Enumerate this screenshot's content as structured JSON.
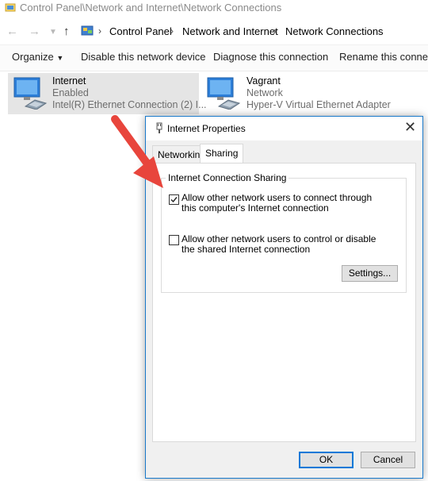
{
  "explorer": {
    "window_title": "Control Panel\\Network and Internet\\Network Connections",
    "breadcrumbs": [
      "Control Panel",
      "Network and Internet",
      "Network Connections"
    ],
    "toolbar": {
      "organize": "Organize",
      "disable": "Disable this network device",
      "diagnose": "Diagnose this connection",
      "rename": "Rename this connection"
    },
    "connections": [
      {
        "name": "Internet",
        "status": "Enabled",
        "adapter": "Intel(R) Ethernet Connection (2) I...",
        "selected": true
      },
      {
        "name": "Vagrant",
        "status": "Network",
        "adapter": "Hyper-V Virtual Ethernet Adapter",
        "selected": false
      }
    ]
  },
  "dialog": {
    "title": "Internet Properties",
    "tabs": [
      "Networking",
      "Sharing"
    ],
    "active_tab": "Sharing",
    "group_label": "Internet Connection Sharing",
    "options": [
      {
        "label": "Allow other network users to connect through this computer's Internet connection",
        "checked": true
      },
      {
        "label": "Allow other network users to control or disable the shared Internet connection",
        "checked": false
      }
    ],
    "settings_button": "Settings...",
    "ok_button": "OK",
    "cancel_button": "Cancel"
  },
  "colors": {
    "accent": "#0078d7",
    "arrow": "#e8453c",
    "selection": "#e5e5e5"
  }
}
